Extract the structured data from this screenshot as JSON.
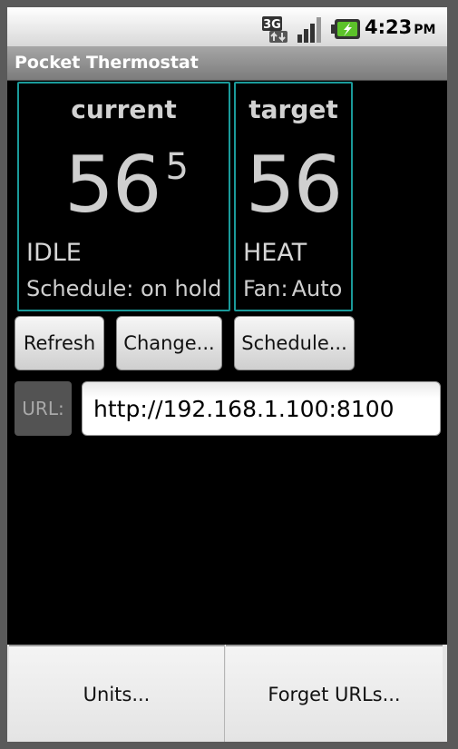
{
  "status_bar": {
    "network_badge": "3G",
    "time": "4:23",
    "ampm": "PM",
    "icons": [
      "network-3g-icon",
      "signal-strength-icon",
      "battery-charging-icon"
    ]
  },
  "app": {
    "title": "Pocket Thermostat"
  },
  "current_panel": {
    "label": "current",
    "temp_whole": "56",
    "temp_fraction": "5",
    "mode": "IDLE",
    "schedule_text": "Schedule: on hold"
  },
  "target_panel": {
    "label": "target",
    "temp": "56",
    "mode": "HEAT",
    "fan_label": "Fan:",
    "fan_value": "Auto"
  },
  "buttons": {
    "refresh": "Refresh",
    "change": "Change...",
    "schedule": "Schedule..."
  },
  "url": {
    "label": "URL:",
    "value": "http://192.168.1.100:8100"
  },
  "menu": {
    "units": "Units...",
    "forget_urls": "Forget URLs..."
  },
  "colors": {
    "panel_border": "#1a9a9a",
    "background": "#000000",
    "text": "#cfcfcf"
  }
}
